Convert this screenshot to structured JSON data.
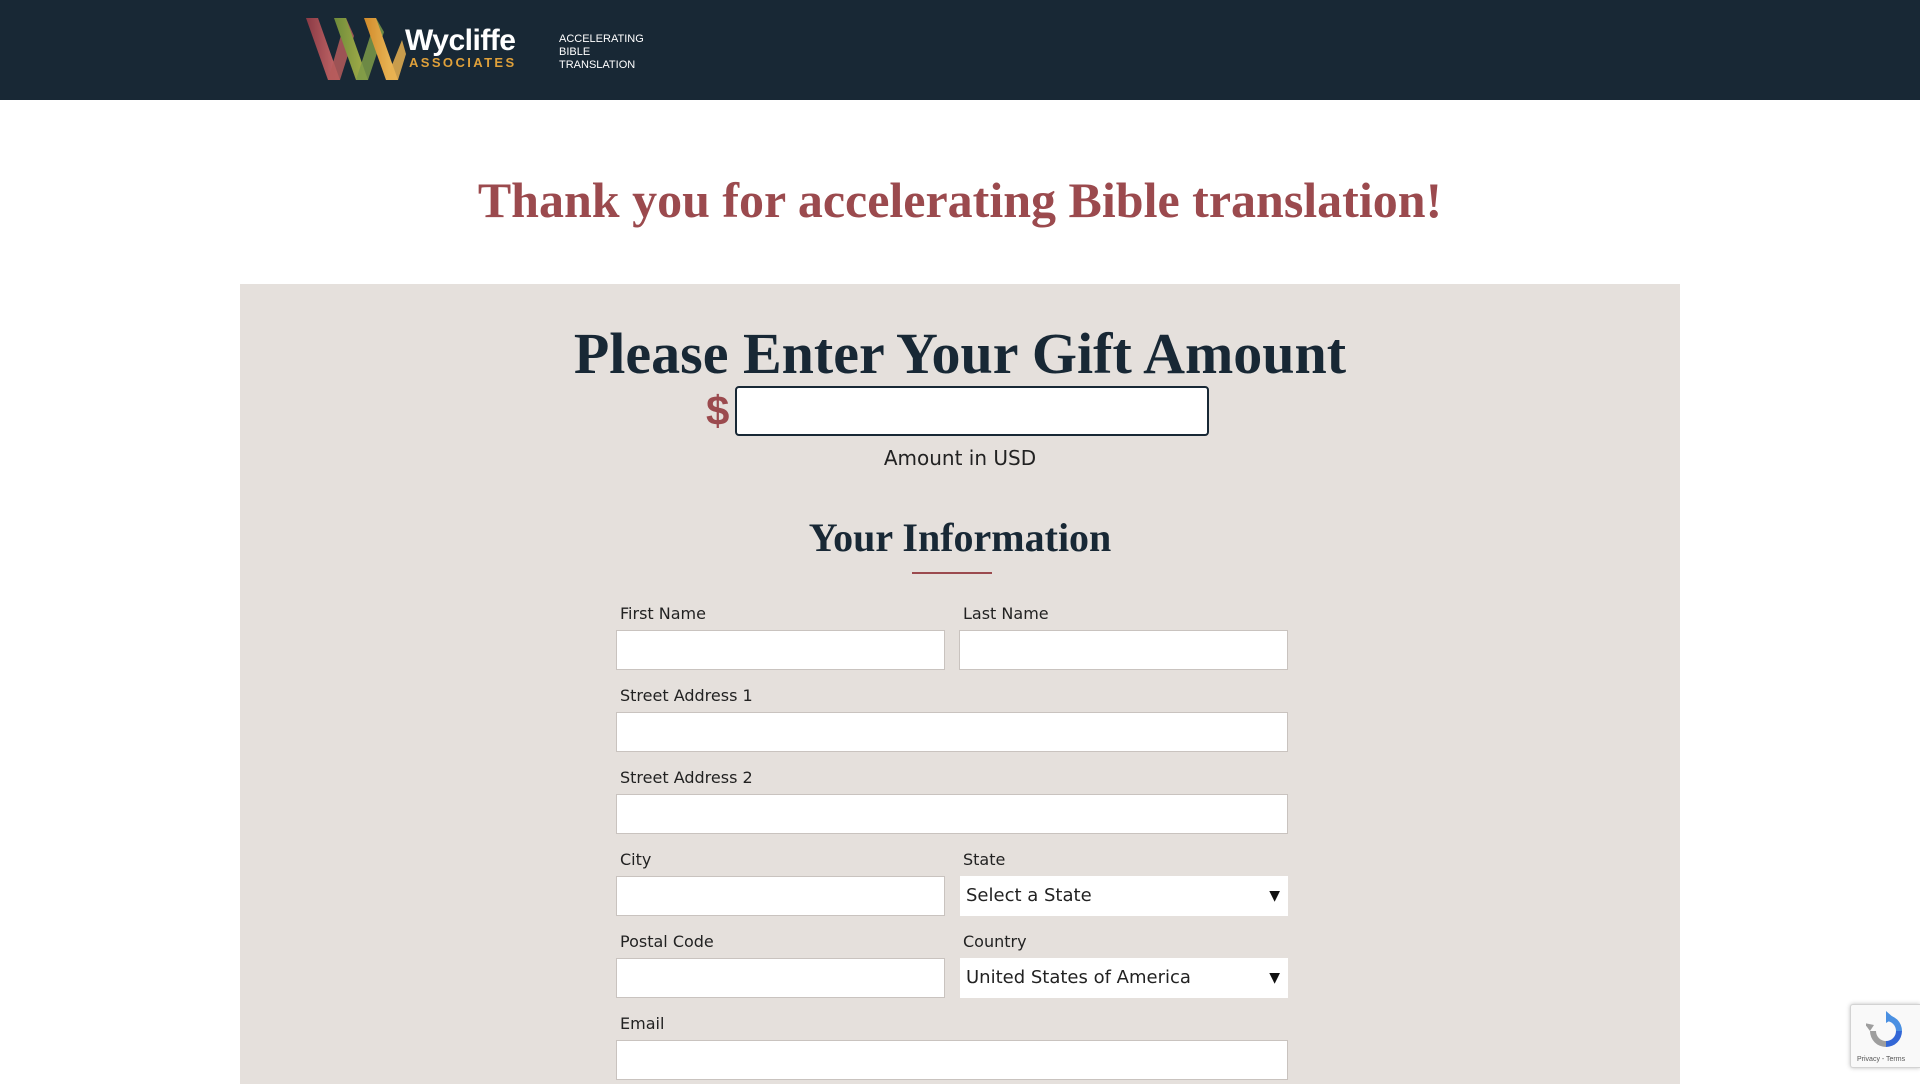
{
  "header": {
    "brand_name": "Wycliffe",
    "brand_sub": "ASSOCIATES",
    "tagline": [
      "ACCELERATING",
      "BIBLE",
      "TRANSLATION"
    ],
    "colors": {
      "background": "#182835",
      "accent": "#e0a13a"
    }
  },
  "thank_you": "Thank you for accelerating Bible translation!",
  "gift": {
    "title": "Please Enter Your Gift Amount",
    "currency_symbol": "$",
    "amount_value": "",
    "amount_caption": "Amount in USD"
  },
  "info": {
    "title": "Your Information",
    "fields": {
      "first_name": {
        "label": "First Name",
        "value": ""
      },
      "last_name": {
        "label": "Last Name",
        "value": ""
      },
      "street1": {
        "label": "Street Address 1",
        "value": ""
      },
      "street2": {
        "label": "Street Address 2",
        "value": ""
      },
      "city": {
        "label": "City",
        "value": ""
      },
      "state": {
        "label": "State",
        "selected": "Select a State"
      },
      "postal_code": {
        "label": "Postal Code",
        "value": ""
      },
      "country": {
        "label": "Country",
        "selected": "United States of America"
      },
      "email": {
        "label": "Email",
        "value": ""
      }
    }
  },
  "recaptcha": {
    "links": "Privacy - Terms",
    "icon": "recaptcha-icon"
  },
  "colors": {
    "headline": "#9b4a4e",
    "panel": "#e5e0dc",
    "title": "#182835"
  }
}
